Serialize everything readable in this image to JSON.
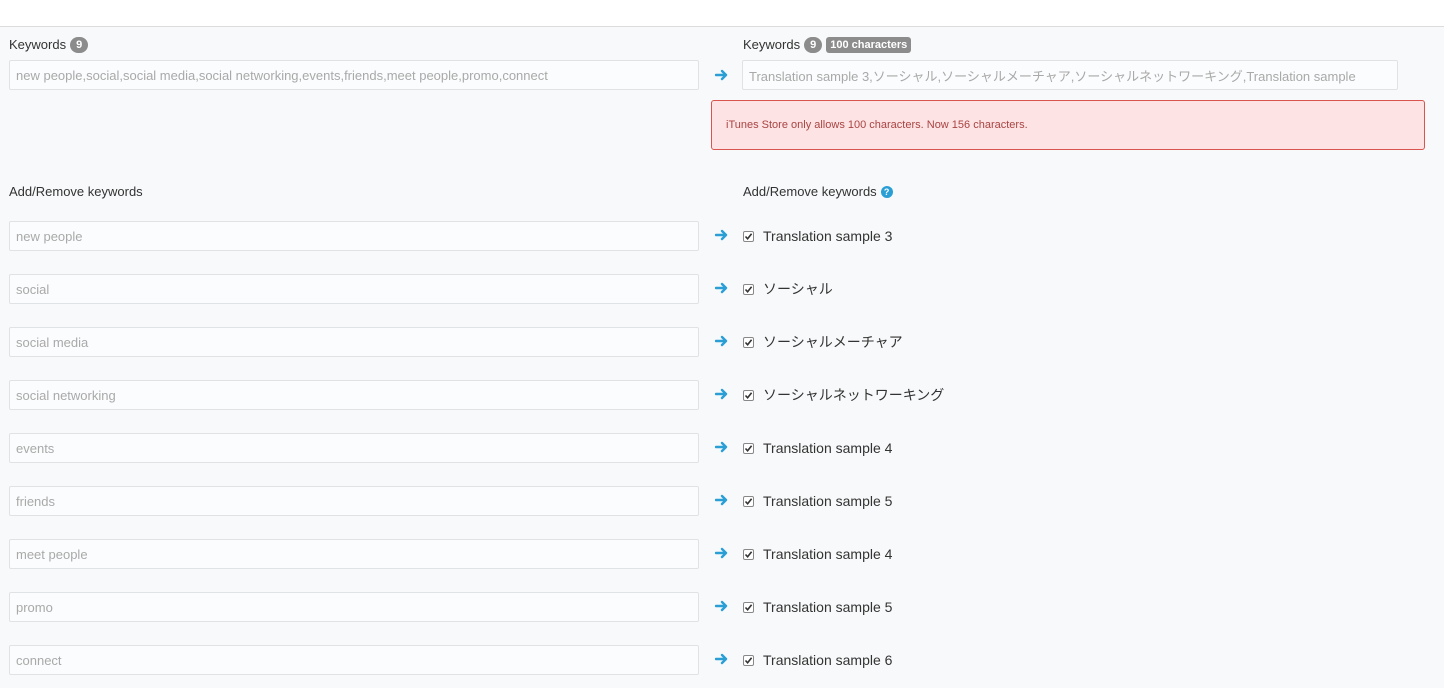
{
  "left": {
    "keywords_label": "Keywords",
    "keywords_count": "9",
    "keywords_field": "new people,social,social media,social networking,events,friends,meet people,promo,connect",
    "add_remove_label": "Add/Remove keywords",
    "items": [
      "new people",
      "social",
      "social media",
      "social networking",
      "events",
      "friends",
      "meet people",
      "promo",
      "connect"
    ]
  },
  "right": {
    "keywords_label": "Keywords",
    "keywords_count": "9",
    "chars_badge": "100 characters",
    "keywords_field": "Translation sample 3,ソーシャル,ソーシャルメーチャア,ソーシャルネットワーキング,Translation sample",
    "alert_text": "iTunes Store only allows 100 characters. Now 156 characters.",
    "add_remove_label": "Add/Remove keywords",
    "help_icon": "?",
    "items": [
      {
        "label": "Translation sample 3",
        "checked": true
      },
      {
        "label": "ソーシャル",
        "checked": true
      },
      {
        "label": "ソーシャルメーチャア",
        "checked": true
      },
      {
        "label": "ソーシャルネットワーキング",
        "checked": true
      },
      {
        "label": "Translation sample 4",
        "checked": true
      },
      {
        "label": "Translation sample 5",
        "checked": true
      },
      {
        "label": "Translation sample 4",
        "checked": true
      },
      {
        "label": "Translation sample 5",
        "checked": true
      },
      {
        "label": "Translation sample 6",
        "checked": true
      }
    ]
  },
  "icons": {
    "arrow": "arrow-right-icon",
    "checkbox": "checkbox-checked-icon",
    "help": "help-icon"
  },
  "colors": {
    "accent": "#2a9fd6",
    "alert_bg": "#fde3e4",
    "alert_border": "#d9534f",
    "alert_text": "#a94442",
    "badge": "#8c8c8c"
  }
}
